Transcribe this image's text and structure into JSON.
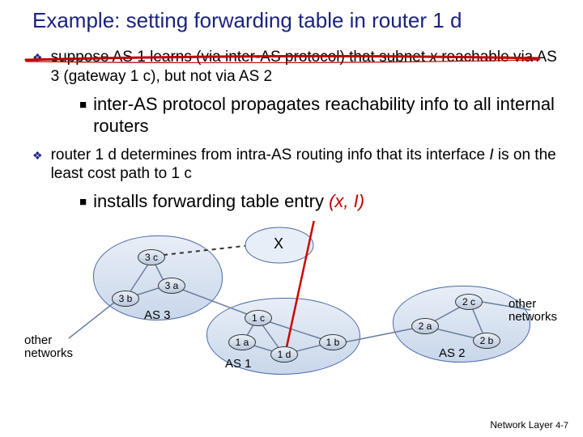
{
  "title": "Example: setting forwarding table in router 1 d",
  "bullets": {
    "b1_pre": "suppose AS 1 learns (via inter-AS protocol) that subnet ",
    "b1_x": "x",
    "b1_post": " reachable via AS 3 (gateway 1 c), but not via AS 2",
    "b2": "inter-AS protocol propagates reachability info to all internal routers",
    "b3_pre": "router 1 d determines from intra-AS routing info that its interface ",
    "b3_I": "I ",
    "b3_post": " is on the least cost path to 1 c",
    "b4_pre": "installs forwarding table entry ",
    "b4_tuple": "(x, I)"
  },
  "nodes": {
    "r3c": "3 c",
    "r3b": "3 b",
    "r3a": "3 a",
    "r1c": "1 c",
    "r1a": "1 a",
    "r1d": "1 d",
    "r1b": "1 b",
    "r2a": "2 a",
    "r2c": "2 c",
    "r2b": "2 b",
    "x": "X"
  },
  "as_labels": {
    "as3": "AS 3",
    "as1": "AS 1",
    "as2": "AS 2"
  },
  "side": {
    "left": "other networks",
    "right": "other networks"
  },
  "footer": {
    "section": "Network Layer",
    "page": "4-7"
  }
}
